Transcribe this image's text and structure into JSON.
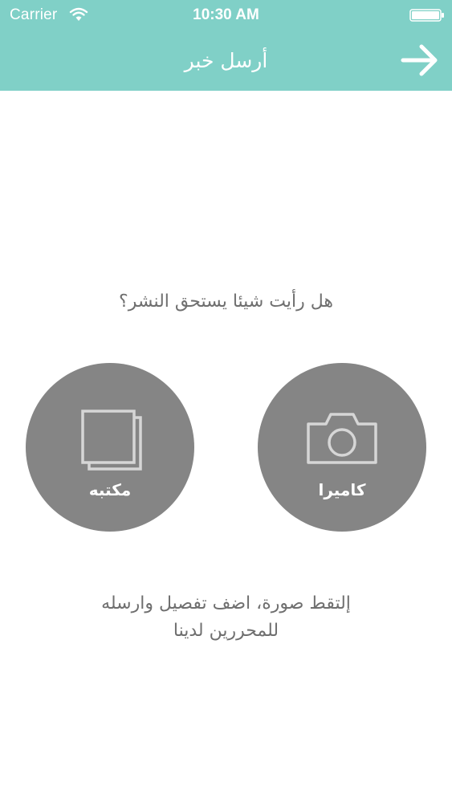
{
  "status_bar": {
    "carrier": "Carrier",
    "time": "10:30 AM",
    "wifi_icon": "wifi-icon",
    "battery_icon": "battery-icon"
  },
  "nav": {
    "title": "أرسل خبر",
    "back_icon": "arrow-right-icon"
  },
  "main": {
    "question": "هل رأيت شيئا يستحق النشر؟",
    "buttons": [
      {
        "label": "مكتبه",
        "icon": "photo-library-icon"
      },
      {
        "label": "كاميرا",
        "icon": "camera-icon"
      }
    ],
    "instructions": {
      "line1": "إلتقط صورة، اضف تفصيل وارسله",
      "line2": "للمحررين لدينا"
    }
  },
  "colors": {
    "header": "#80d0c7",
    "circle": "#858585",
    "text": "#6f6f6f"
  }
}
